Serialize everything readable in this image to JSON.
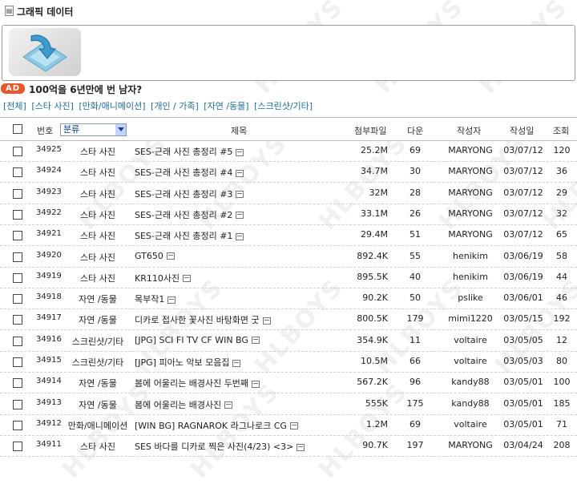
{
  "header": {
    "title": "그래픽 데이터"
  },
  "ad": {
    "badge": "AD",
    "text": "100억을 6년만에 번 남자?"
  },
  "categories": [
    "[전체]",
    "[스타 사진]",
    "[만화/애니메이션]",
    "[개인 / 가족]",
    "[자연 /동물]",
    "[스크린샷/기타]"
  ],
  "table": {
    "headers": {
      "number": "번호",
      "category_select": "분류",
      "title": "제목",
      "attachment": "첨부파일",
      "downloads": "다운",
      "author": "작성자",
      "date": "작성일",
      "views": "조회"
    },
    "rows": [
      {
        "num": "34925",
        "cat": "스타 사진",
        "title": "SES-근래 사진 총정리 #5",
        "size": "25.2M",
        "down": "69",
        "author": "MARYONG",
        "date": "03/07/12",
        "views": "120"
      },
      {
        "num": "34924",
        "cat": "스타 사진",
        "title": "SES-근래 사진 총정리 #4",
        "size": "34.7M",
        "down": "30",
        "author": "MARYONG",
        "date": "03/07/12",
        "views": "36"
      },
      {
        "num": "34923",
        "cat": "스타 사진",
        "title": "SES-근래 사진 총정리 #3",
        "size": "32M",
        "down": "28",
        "author": "MARYONG",
        "date": "03/07/12",
        "views": "29"
      },
      {
        "num": "34922",
        "cat": "스타 사진",
        "title": "SES-근래 사진 총정리 #2",
        "size": "33.1M",
        "down": "26",
        "author": "MARYONG",
        "date": "03/07/12",
        "views": "32"
      },
      {
        "num": "34921",
        "cat": "스타 사진",
        "title": "SES-근래 사진 총정리 #1",
        "size": "29.4M",
        "down": "51",
        "author": "MARYONG",
        "date": "03/07/12",
        "views": "65"
      },
      {
        "num": "34920",
        "cat": "스타 사진",
        "title": "GT650",
        "size": "892.4K",
        "down": "55",
        "author": "henikim",
        "date": "03/06/19",
        "views": "58"
      },
      {
        "num": "34919",
        "cat": "스타 사진",
        "title": "KR110사진",
        "size": "895.5K",
        "down": "40",
        "author": "henikim",
        "date": "03/06/19",
        "views": "44"
      },
      {
        "num": "34918",
        "cat": "자연 /동물",
        "title": "목부작1",
        "size": "90.2K",
        "down": "50",
        "author": "pslike",
        "date": "03/06/01",
        "views": "46"
      },
      {
        "num": "34917",
        "cat": "자연 /동물",
        "title": "디카로 접사한 꽃사진 바탕화면 굿",
        "size": "800.5K",
        "down": "179",
        "author": "mimi1220",
        "date": "03/05/15",
        "views": "192"
      },
      {
        "num": "34916",
        "cat": "스크린샷/기타",
        "title": "[JPG] SCI FI TV CF WIN BG",
        "size": "354.9K",
        "down": "11",
        "author": "voltaire",
        "date": "03/05/05",
        "views": "12"
      },
      {
        "num": "34915",
        "cat": "스크린샷/기타",
        "title": "[JPG] 피아노 악보 모음집",
        "size": "10.5M",
        "down": "66",
        "author": "voltaire",
        "date": "03/05/03",
        "views": "80"
      },
      {
        "num": "34914",
        "cat": "자연 /동물",
        "title": "봄에 어울리는 배경사진 두번째",
        "size": "567.2K",
        "down": "96",
        "author": "kandy88",
        "date": "03/05/01",
        "views": "100"
      },
      {
        "num": "34913",
        "cat": "자연 /동물",
        "title": "봄에 어울리는 배경사진",
        "size": "555K",
        "down": "175",
        "author": "kandy88",
        "date": "03/05/01",
        "views": "185"
      },
      {
        "num": "34912",
        "cat": "만화/애니메이션",
        "title": "[WIN BG] RAGNAROK 라그나로크 CG",
        "size": "1.2M",
        "down": "69",
        "author": "voltaire",
        "date": "03/05/01",
        "views": "71"
      },
      {
        "num": "34911",
        "cat": "스타 사진",
        "title": "SES 바다를 디카로 찍은 사진(4/23) <3>",
        "size": "90.7K",
        "down": "197",
        "author": "MARYONG",
        "date": "03/04/24",
        "views": "208"
      }
    ]
  },
  "icons": {
    "title": "document-icon",
    "banner": "download-arrow-icon",
    "comment": "comment-icon"
  },
  "watermark": "HLBOYS",
  "colors": {
    "ad_badge": "#e8562b",
    "category_link": "#1f6e9a",
    "select_text": "#0a3a8a"
  }
}
